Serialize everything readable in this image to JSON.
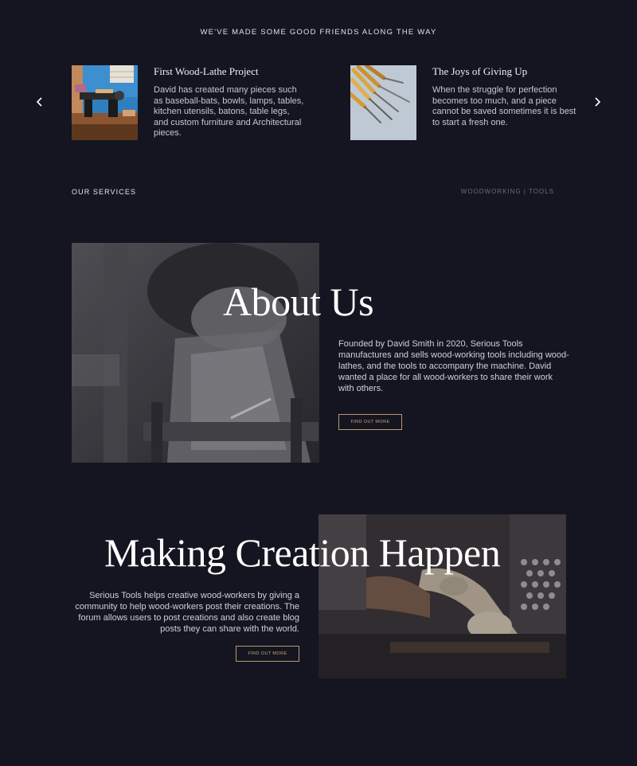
{
  "friends": {
    "heading": "WE'VE MADE SOME GOOD FRIENDS ALONG THE WAY",
    "prev_icon": "chevron-left-icon",
    "next_icon": "chevron-right-icon",
    "cards": [
      {
        "title": "First Wood-Lathe Project",
        "body": "David has created many pieces such as baseball-bats, bowls, lamps, tables, kitchen utensils, batons, table legs, and custom furniture and Architectural pieces."
      },
      {
        "title": "The Joys of Giving Up",
        "body": "When the struggle for perfection becomes too much, and a piece cannot be saved sometimes it is best to start a fresh one."
      }
    ]
  },
  "services": {
    "label": "OUR SERVICES",
    "tags": "WOODWORKING | TOOLS"
  },
  "about": {
    "title": "About Us",
    "body": "Founded by David Smith in 2020, Serious Tools manufactures and sells wood-working tools including wood-lathes, and the tools to accompany the machine. David wanted a place for all wood-workers to share their work with others.",
    "button": "FIND OUT MORE"
  },
  "making": {
    "title": "Making Creation Happen",
    "body": "Serious Tools  helps creative wood-workers by giving a community to help wood-workers post their creations. The forum allows users to post creations and also create blog posts they can share with the world.",
    "button": "FIND OUT MORE"
  },
  "colors": {
    "background": "#141521",
    "accent": "#b89a6a"
  }
}
